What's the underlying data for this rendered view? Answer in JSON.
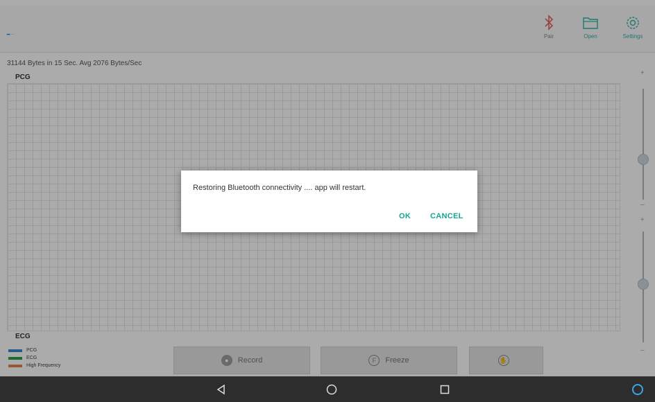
{
  "app": {
    "logo": {
      "mark": "━",
      "text": "┈"
    },
    "toolbar": [
      {
        "name": "bluetooth",
        "label": "Pair",
        "icon": "bluetooth-icon"
      },
      {
        "name": "open",
        "label": "Open",
        "icon": "folder-icon"
      },
      {
        "name": "settings",
        "label": "Settings",
        "icon": "gear-icon"
      }
    ],
    "status_text": "31144 Bytes in 15 Sec. Avg 2076 Bytes/Sec",
    "charts": {
      "top_label": "PCG",
      "bottom_label": "ECG"
    },
    "legend": [
      {
        "label": "PCG",
        "color": "#3b86c8"
      },
      {
        "label": "ECG",
        "color": "#2e9e4a"
      },
      {
        "label": "High Frequency",
        "color": "#e0844a"
      }
    ],
    "actions": [
      {
        "label": "Record",
        "icon": "record-icon"
      },
      {
        "label": "Freeze",
        "icon": "freeze-icon"
      },
      {
        "label": "",
        "icon": "hand-icon"
      }
    ],
    "sliders": {
      "top_plus": "+",
      "top_minus": "–",
      "bottom_plus": "+",
      "bottom_minus": "–"
    }
  },
  "dialog": {
    "message": "Restoring Bluetooth connectivity .... app will restart.",
    "ok_label": "OK",
    "cancel_label": "CANCEL"
  },
  "navbar": {
    "icons": [
      "back-icon",
      "home-icon",
      "recents-icon",
      "assistant-icon"
    ]
  },
  "colors": {
    "accent": "#16a394",
    "scrim": "rgba(0,0,0,0.33)",
    "navbar": "#2d2d2d"
  }
}
